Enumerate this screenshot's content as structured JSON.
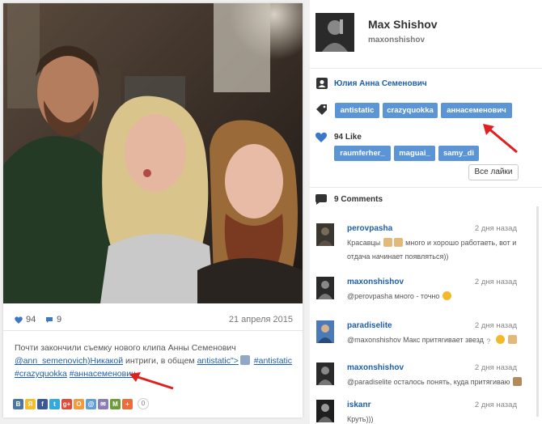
{
  "post": {
    "likes": "94",
    "comments": "9",
    "date": "21 апреля 2015",
    "caption_line1": "Почти закончили съемку нового клипа Анны Семенович",
    "mention_link": "@ann_semenovich)Никакой",
    "caption_mid": " интриги, в общем ",
    "link2": "antistatic\">",
    "hashtag1": "#antistatic",
    "hashtag2": "#crazyquokka",
    "hashtag3": "#аннасеменович",
    "share_count": "0",
    "share_icons": [
      "В",
      "Я",
      "f",
      "t",
      "g+",
      "O",
      "@",
      "✉",
      "M",
      "+"
    ],
    "share_colors": [
      "#4c75a3",
      "#f8bb2a",
      "#3b5998",
      "#33aadd",
      "#dd4b39",
      "#f59a3c",
      "#5f9ed6",
      "#8a7cb5",
      "#6c9c3a",
      "#ee6b3a"
    ]
  },
  "profile": {
    "name": "Max Shishov",
    "handle": "maxonshishov"
  },
  "tagged_user": "Юлия Анна Семенович",
  "tags": [
    "antistatic",
    "crazyquokka",
    "аннасеменович"
  ],
  "likes_section": {
    "count_label": "94 Like",
    "likers": [
      "raumferher_",
      "maguai_",
      "samy_di"
    ],
    "all_button": "Все лайки"
  },
  "comments_section": {
    "header": "9 Comments",
    "items": [
      {
        "user": "perovpasha",
        "time": "2 дня назад",
        "text_a": "Красавцы ",
        "text_b": " много и хорошо работаеть, вот и",
        "text_c": "отдача начинает появляться))"
      },
      {
        "user": "maxonshishov",
        "time": "2 дня назад",
        "text_a": "@perovpasha много - точно ",
        "text_b": "",
        "text_c": ""
      },
      {
        "user": "paradiselite",
        "time": "2 дня назад",
        "text_a": "@maxonshishov Макс притягивает звезд ",
        "text_b": "",
        "text_c": ""
      },
      {
        "user": "maxonshishov",
        "time": "2 дня назад",
        "text_a": "@paradiselite осталось понять, куда притягиваю ",
        "text_b": "",
        "text_c": ""
      },
      {
        "user": "iskanr",
        "time": "2 дня назад",
        "text_a": "Круть)))",
        "text_b": "",
        "text_c": ""
      }
    ]
  },
  "colors": {
    "accent": "#5b95d6",
    "link": "#1e5fa6",
    "heart": "#3a78c7",
    "arrow": "#e02020"
  }
}
